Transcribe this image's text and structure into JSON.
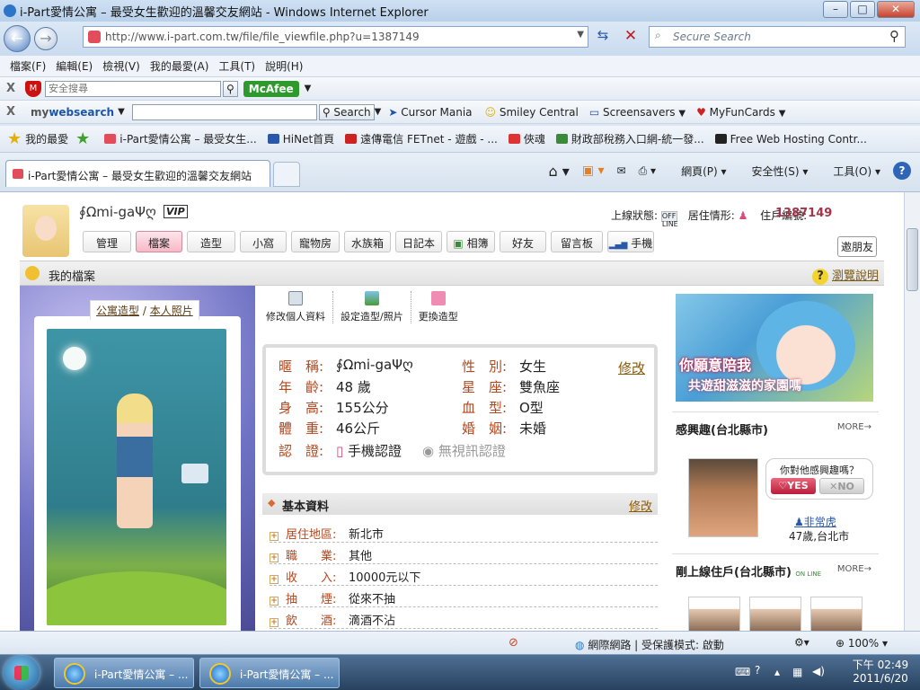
{
  "window": {
    "title": "i-Part愛情公寓 – 最受女生歡迎的溫馨交友網站 - Windows Internet Explorer",
    "min": "–",
    "max": "□",
    "close": "✕"
  },
  "nav": {
    "url": "http://www.i-part.com.tw/file/file_viewfile.php?u=1387149",
    "search_placeholder": "Secure Search"
  },
  "menu": [
    "檔案(F)",
    "編輯(E)",
    "檢視(V)",
    "我的最愛(A)",
    "工具(T)",
    "說明(H)"
  ],
  "toolbar1": {
    "search_placeholder": "安全搜尋",
    "mcafee": "McAfee"
  },
  "toolbar2": {
    "brand_a": "my",
    "brand_b": "websearch",
    "search_btn": "Search",
    "links": [
      "Cursor Mania",
      "Smiley Central",
      "Screensavers",
      "MyFunCards"
    ]
  },
  "favbar": {
    "label": "我的最愛",
    "items": [
      "i-Part愛情公寓 – 最受女生...",
      "HiNet首頁",
      "遠傳電信 FETnet - 遊戲 - ...",
      "俠魂",
      "財政部稅務入口網-統一發...",
      "Free Web Hosting Contr..."
    ]
  },
  "tab": {
    "title": "i-Part愛情公寓 – 最受女生歡迎的溫馨交友網站",
    "tools": [
      "網頁(P)",
      "安全性(S)",
      "工具(O)"
    ]
  },
  "profile": {
    "username": "∮Ωmi-gaΨღ",
    "vip": "VIP",
    "online_label": "上線狀態:",
    "offline": "OFF LINE",
    "residence_label": "居住情形:",
    "resident_no_label": "住戶編號:",
    "resident_no": "1387149",
    "tabs": [
      "管理",
      "檔案",
      "造型",
      "小窩",
      "寵物房",
      "水族箱",
      "日記本",
      "相簿",
      "好友",
      "留言板",
      "手機"
    ],
    "invite": "邀朋友"
  },
  "section": {
    "title": "我的檔案",
    "browse": "瀏覽說明"
  },
  "photo": {
    "tab_a": "公寓造型",
    "tab_sep": "/",
    "tab_b": "本人照片"
  },
  "edits": [
    "修改個人資料",
    "設定造型/照片",
    "更換造型"
  ],
  "info": {
    "nick_l": "暱　稱:",
    "nick": "∮Ωmi-gaΨღ",
    "gender_l": "性　別:",
    "gender": "女生",
    "modify": "修改",
    "age_l": "年　齡:",
    "age": "48 歲",
    "star_l": "星　座:",
    "star": "雙魚座",
    "height_l": "身　高:",
    "height": "155公分",
    "blood_l": "血　型:",
    "blood": "O型",
    "weight_l": "體　重:",
    "weight": "46公斤",
    "marry_l": "婚　姻:",
    "marry": "未婚",
    "cert_l": "認　證:",
    "cert1": "手機認證",
    "cert2": "無視訊認證"
  },
  "basic": {
    "title": "基本資料",
    "modify": "修改",
    "rows": [
      {
        "l": "居住地區:",
        "v": "新北市"
      },
      {
        "l": "職　　業:",
        "v": "其他"
      },
      {
        "l": "收　　入:",
        "v": "10000元以下"
      },
      {
        "l": "抽　　煙:",
        "v": "從來不抽"
      },
      {
        "l": "飲　　酒:",
        "v": "滴酒不沾"
      }
    ]
  },
  "right": {
    "ad_line1": "你願意陪我",
    "ad_line2": "共遊甜滋滋的家園嗎",
    "interest_title": "感興趣(台北縣市)",
    "more": "MORE→",
    "bubble": "你對他感興趣嗎？",
    "yes": "♡YES",
    "no": "✕NO",
    "person": "非常虎",
    "person_info": "47歲,台北市",
    "online_title": "剛上線住戶(台北縣市)",
    "online_badge": "ON LINE"
  },
  "status": {
    "zone": "網際網路 | 受保護模式: 啟動",
    "zoom": "100%"
  },
  "taskbar": {
    "tasks": [
      "i-Part愛情公寓 – ...",
      "i-Part愛情公寓 – ..."
    ],
    "time": "下午 02:49",
    "date": "2011/6/20"
  }
}
